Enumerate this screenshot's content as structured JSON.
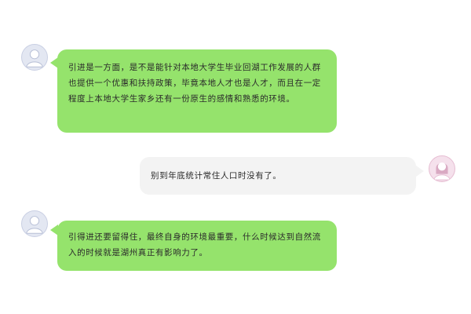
{
  "colors": {
    "incoming_bubble": "#95e36c",
    "outgoing_bubble": "#f3f3f3",
    "text": "#2b2b2b"
  },
  "messages": [
    {
      "side": "left",
      "avatar_icon": "user-avatar-icon",
      "text": "引进是一方面，是不是能针对本地大学生毕业回湖工作发展的人群也提供一个优惠和扶持政策，毕竟本地人才也是人才，而且在一定程度上本地大学生家乡还有一份原生的感情和熟悉的环境。"
    },
    {
      "side": "right",
      "avatar_icon": "user-avatar-icon",
      "text": "别到年底统计常住人口时没有了。"
    },
    {
      "side": "left",
      "avatar_icon": "user-avatar-icon",
      "text": "引得进还要留得住，最终自身的环境最重要，什么时候达到自然流入的时候就是湖州真正有影响力了。"
    }
  ]
}
